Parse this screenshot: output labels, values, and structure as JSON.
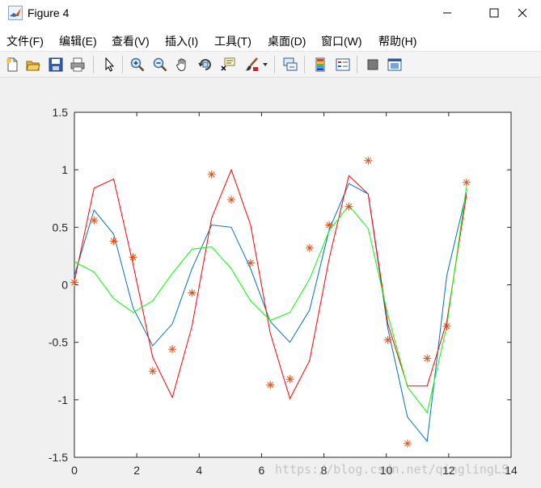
{
  "window": {
    "title": "Figure 4",
    "controls": [
      "minimize",
      "maximize",
      "close"
    ]
  },
  "menu": {
    "items": [
      {
        "label": "文件(F)"
      },
      {
        "label": "编辑(E)"
      },
      {
        "label": "查看(V)"
      },
      {
        "label": "插入(I)"
      },
      {
        "label": "工具(T)"
      },
      {
        "label": "桌面(D)"
      },
      {
        "label": "窗口(W)"
      },
      {
        "label": "帮助(H)"
      }
    ]
  },
  "toolbar": {
    "buttons": [
      "new-figure-icon",
      "open-file-icon",
      "save-icon",
      "print-icon",
      "edit-plot-arrow-icon",
      "zoom-in-icon",
      "zoom-out-icon",
      "pan-hand-icon",
      "rotate-3d-icon",
      "data-cursor-icon",
      "brush-icon",
      "brush-dropdown-icon",
      "link-plot-icon",
      "colorbar-icon",
      "legend-icon",
      "hide-plot-tools-icon",
      "show-plot-tools-icon"
    ]
  },
  "watermark": "https://blog.csdn.net/qinglingLS",
  "colors": {
    "series_blue": "#0072bd",
    "series_red": "#ff0000",
    "series_green": "#00ff00",
    "markers": "#d95319"
  },
  "chart_data": {
    "type": "line",
    "xlim": [
      0,
      14
    ],
    "ylim": [
      -1.5,
      1.5
    ],
    "xticks": [
      0,
      2,
      4,
      6,
      8,
      10,
      12,
      14
    ],
    "yticks": [
      -1.5,
      -1,
      -0.5,
      0,
      0.5,
      1,
      1.5
    ],
    "xtick_labels": [
      "0",
      "2",
      "4",
      "6",
      "8",
      "10",
      "12",
      "14"
    ],
    "ytick_labels": [
      "-1.5",
      "-1",
      "-0.5",
      "0",
      "0.5",
      "1",
      "1.5"
    ],
    "grid": false,
    "x": [
      0,
      0.63,
      1.26,
      1.88,
      2.51,
      3.14,
      3.77,
      4.4,
      5.03,
      5.65,
      6.28,
      6.91,
      7.54,
      8.17,
      8.8,
      9.42,
      10.05,
      10.68,
      11.31,
      11.94,
      12.57
    ],
    "series": [
      {
        "color": "#0072bd",
        "style": "line",
        "values": [
          0.08,
          0.65,
          0.44,
          -0.2,
          -0.53,
          -0.34,
          0.14,
          0.52,
          0.5,
          0.14,
          -0.32,
          -0.5,
          -0.22,
          0.48,
          0.88,
          0.79,
          -0.38,
          -1.15,
          -1.36,
          0.08,
          0.8
        ]
      },
      {
        "color": "#ff0000",
        "style": "line",
        "values": [
          0.03,
          0.84,
          0.92,
          0.18,
          -0.63,
          -0.98,
          -0.36,
          0.58,
          1.0,
          0.52,
          -0.42,
          -0.99,
          -0.66,
          0.23,
          0.95,
          0.79,
          -0.34,
          -0.88,
          -0.88,
          -0.32,
          0.78
        ]
      },
      {
        "color": "#00ff00",
        "style": "line",
        "values": [
          0.2,
          0.11,
          -0.12,
          -0.24,
          -0.14,
          0.1,
          0.31,
          0.33,
          0.14,
          -0.14,
          -0.31,
          -0.24,
          0.05,
          0.47,
          0.69,
          0.49,
          -0.26,
          -0.89,
          -1.11,
          -0.36,
          0.85
        ]
      },
      {
        "color": "#d95319",
        "style": "markers",
        "values": [
          0.02,
          0.56,
          0.38,
          0.24,
          -0.75,
          -0.56,
          -0.07,
          0.96,
          0.74,
          0.19,
          -0.87,
          -0.82,
          0.32,
          0.52,
          0.68,
          1.08,
          -0.48,
          -1.38,
          -0.64,
          -0.36,
          0.89
        ]
      }
    ]
  }
}
